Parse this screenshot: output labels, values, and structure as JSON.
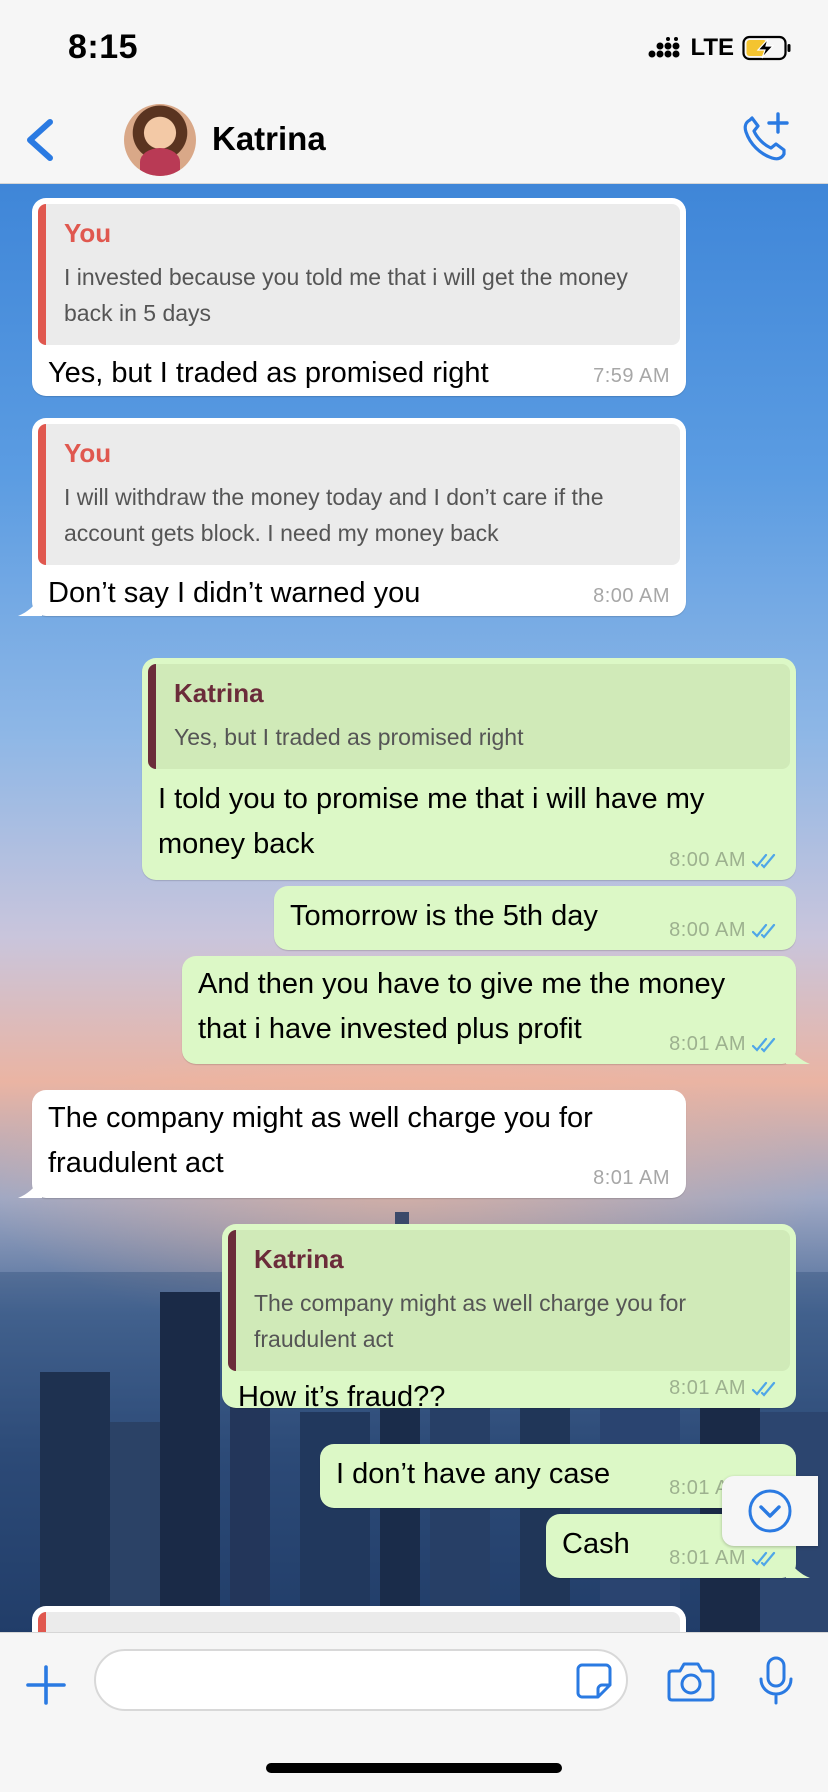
{
  "status_bar": {
    "time": "8:15",
    "network": "LTE"
  },
  "header": {
    "contact_name": "Katrina"
  },
  "messages": [
    {
      "quote_name": "You",
      "quote_text": "I invested because you told me that i will get the money back in 5 days",
      "text": "Yes, but I traded as promised right",
      "time": "7:59 AM"
    },
    {
      "quote_name": "You",
      "quote_text": "I will withdraw the money today and I don’t care if the account gets block. I need my money back",
      "text": "Don’t say I didn’t warned you",
      "time": "8:00 AM"
    },
    {
      "quote_name": "Katrina",
      "quote_text": "Yes, but I traded as promised right",
      "text": "I told you to promise me that i will have my money back",
      "time": "8:00 AM"
    },
    {
      "text": "Tomorrow is the 5th day",
      "time": "8:00 AM"
    },
    {
      "text": "And then you have to give me the money that i have invested plus profit",
      "time": "8:01 AM"
    },
    {
      "text": "The company might as well charge you for fraudulent act",
      "time": "8:01 AM"
    },
    {
      "quote_name": "Katrina",
      "quote_text": "The company might as well charge you for fraudulent act",
      "text": "How it’s fraud??",
      "time": "8:01 AM"
    },
    {
      "text": "I don’t have any case",
      "time": "8:01 AM"
    },
    {
      "text": "Cash",
      "time": "8:01 AM"
    }
  ],
  "composer": {
    "value": "",
    "placeholder": ""
  },
  "colors": {
    "accent": "#2a7ae2",
    "incoming": "#ffffff",
    "outgoing": "#dcf8c6",
    "quote_you": "#e0584f",
    "quote_katrina": "#6b2c3a"
  },
  "icons": [
    "back-chevron-icon",
    "add-call-icon",
    "plus-icon",
    "sticker-icon",
    "camera-icon",
    "mic-icon",
    "scroll-down-icon",
    "read-receipt-icon",
    "charging-battery-icon",
    "signal-icon"
  ]
}
